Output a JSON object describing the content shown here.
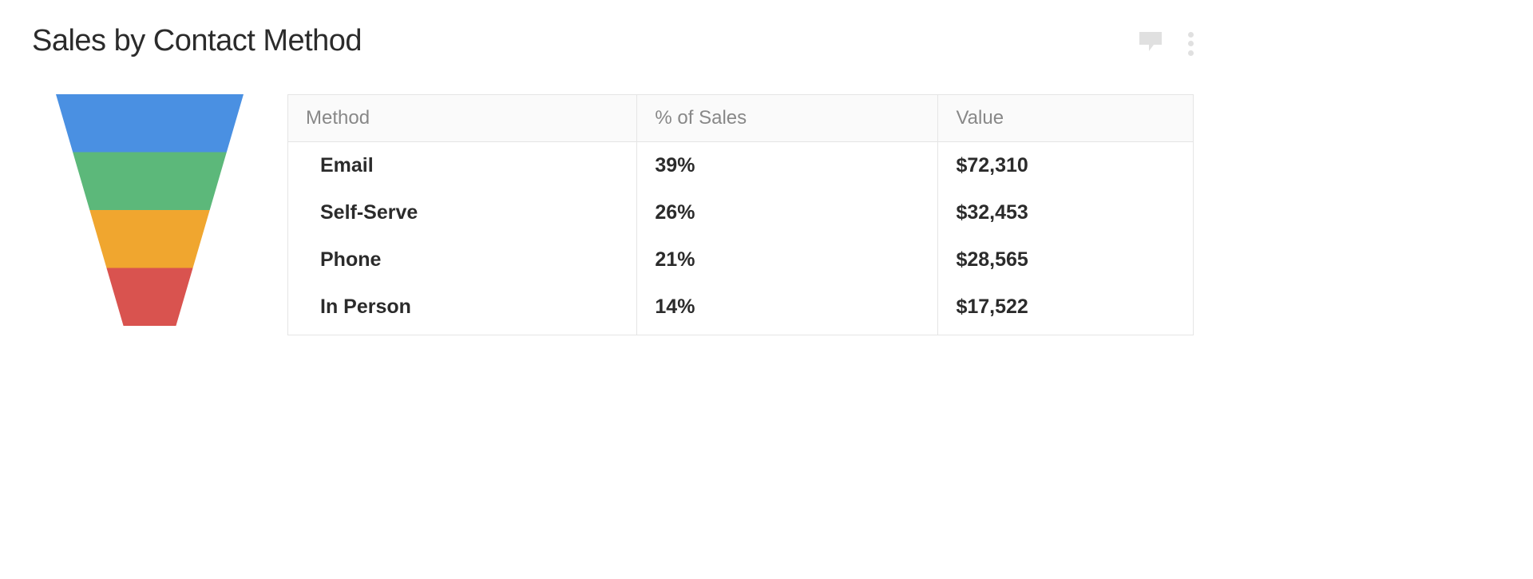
{
  "widget": {
    "title": "Sales by Contact Method"
  },
  "table": {
    "headers": {
      "method": "Method",
      "percent": "% of Sales",
      "value": "Value"
    },
    "rows": [
      {
        "method": "Email",
        "percent": "39%",
        "value": "$72,310"
      },
      {
        "method": "Self-Serve",
        "percent": "26%",
        "value": "$32,453"
      },
      {
        "method": "Phone",
        "percent": "21%",
        "value": "$28,565"
      },
      {
        "method": "In Person",
        "percent": "14%",
        "value": "$17,522"
      }
    ]
  },
  "funnel": {
    "colors": [
      "#4a90e2",
      "#5cb87a",
      "#f0a62f",
      "#d9534f"
    ]
  },
  "chart_data": {
    "type": "table",
    "title": "Sales by Contact Method",
    "columns": [
      "Method",
      "% of Sales",
      "Value"
    ],
    "series": [
      {
        "name": "Email",
        "percent_of_sales": 39,
        "value_usd": 72310,
        "color": "#4a90e2"
      },
      {
        "name": "Self-Serve",
        "percent_of_sales": 26,
        "value_usd": 32453,
        "color": "#5cb87a"
      },
      {
        "name": "Phone",
        "percent_of_sales": 21,
        "value_usd": 28565,
        "color": "#f0a62f"
      },
      {
        "name": "In Person",
        "percent_of_sales": 14,
        "value_usd": 17522,
        "color": "#d9534f"
      }
    ],
    "funnel_visual": {
      "type": "funnel",
      "segments": 4,
      "orientation": "descending"
    }
  }
}
